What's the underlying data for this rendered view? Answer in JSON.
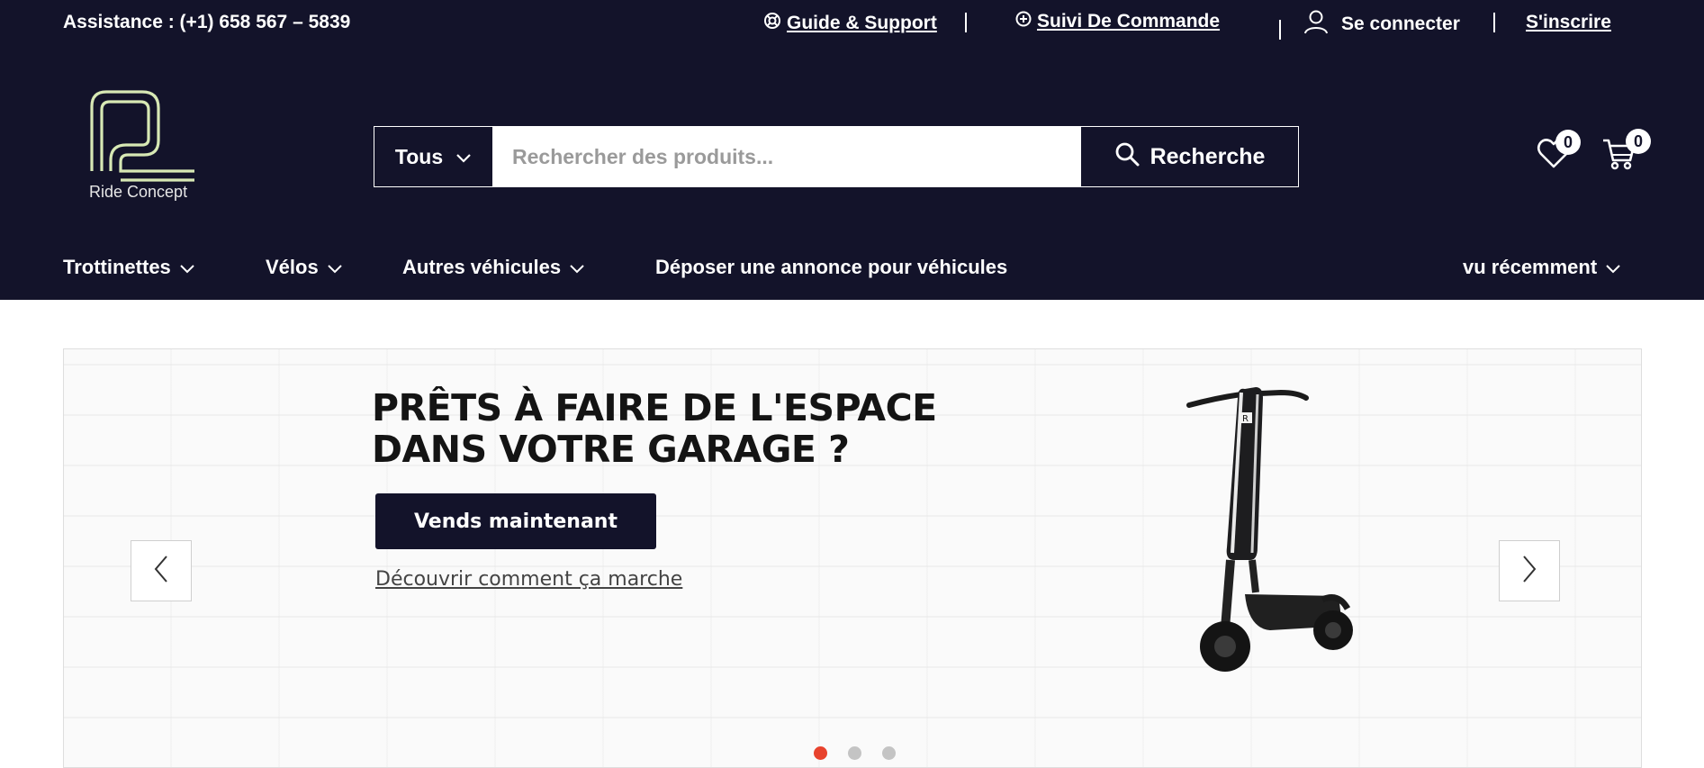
{
  "topbar": {
    "assistance": "Assistance : (+1) 658 567 – 5839",
    "guide": "Guide & Support",
    "tracking": "Suivi De Commande",
    "login": "Se connecter",
    "signup": "S'inscrire"
  },
  "logo": {
    "text": "Ride Concept"
  },
  "search": {
    "category": "Tous",
    "placeholder": "Rechercher des produits...",
    "button": "Recherche"
  },
  "counts": {
    "wishlist": "0",
    "cart": "0"
  },
  "nav": {
    "items": [
      "Trottinettes",
      "Vélos",
      "Autres véhicules",
      "Déposer une annonce pour véhicules"
    ],
    "recent": "vu récemment"
  },
  "hero": {
    "title_line1": "PRÊTS À FAIRE DE L'ESPACE",
    "title_line2": "DANS VOTRE GARAGE ?",
    "cta": "Vends maintenant",
    "link": "Découvrir comment ça marche",
    "slides": 3,
    "active_slide": 1
  },
  "colors": {
    "header_bg": "#13132a",
    "accent_dot": "#e8432d"
  },
  "icons": [
    "support-icon",
    "tracking-icon",
    "user-icon",
    "chevron-down-icon",
    "search-icon",
    "heart-icon",
    "cart-icon",
    "arrow-left-icon",
    "arrow-right-icon"
  ]
}
